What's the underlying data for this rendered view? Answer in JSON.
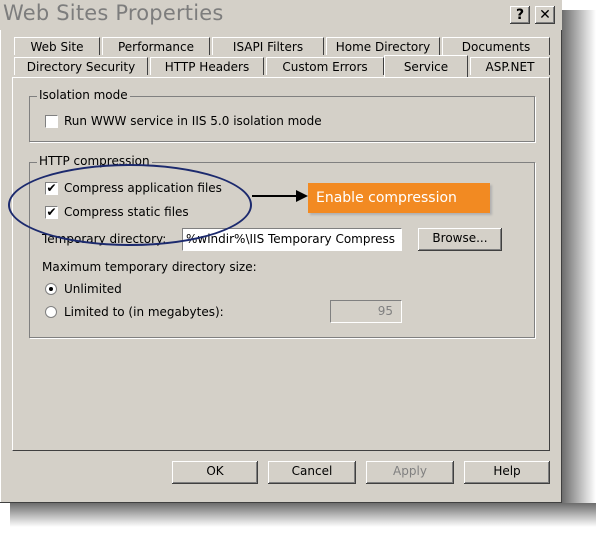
{
  "window": {
    "title": "Web Sites Properties",
    "help_btn": "?",
    "close_btn": "✕"
  },
  "tabs_row_top": [
    "Web Site",
    "Performance",
    "ISAPI Filters",
    "Home Directory",
    "Documents"
  ],
  "tabs_row_bottom": [
    "Directory Security",
    "HTTP Headers",
    "Custom Errors",
    "Service",
    "ASP.NET"
  ],
  "active_tab": "Service",
  "isolation": {
    "group_label": "Isolation mode",
    "checkbox_label": "Run WWW service in IIS 5.0 isolation mode",
    "checked": false
  },
  "compression": {
    "group_label": "HTTP compression",
    "app_files_label": "Compress application files",
    "app_files_checked": true,
    "static_files_label": "Compress static files",
    "static_files_checked": true,
    "temp_dir_label": "Temporary directory:",
    "temp_dir_value": "%windir%\\IIS Temporary Compress",
    "browse_label": "Browse...",
    "max_size_label": "Maximum temporary directory size:",
    "unlimited_label": "Unlimited",
    "unlimited_selected": true,
    "limited_label": "Limited to (in megabytes):",
    "limited_value": "95"
  },
  "annotation": {
    "callout_text": "Enable compression",
    "color": "#f28a22"
  },
  "buttons": {
    "ok": "OK",
    "cancel": "Cancel",
    "apply": "Apply",
    "help": "Help"
  }
}
